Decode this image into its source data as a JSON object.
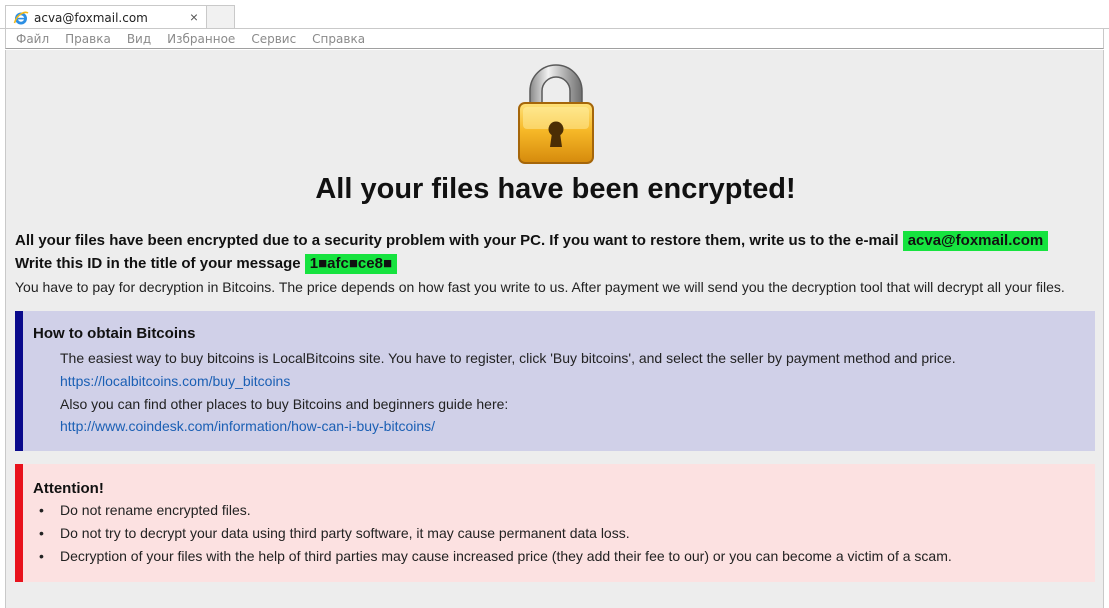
{
  "tab": {
    "title": "acva@foxmail.com",
    "close": "×"
  },
  "menubar": {
    "items": [
      "Файл",
      "Правка",
      "Вид",
      "Избранное",
      "Сервис",
      "Справка"
    ]
  },
  "page": {
    "headline": "All your files have been encrypted!",
    "line1_text": "All your files have been encrypted due to a security problem with your PC. If you want to restore them, write us to the e-mail",
    "email": "acva@foxmail.com",
    "line2_text": "Write this ID in the title of your message",
    "id": "1■afc■ce8■",
    "line3_text": "You have to pay for decryption in Bitcoins. The price depends on how fast you write to us. After payment we will send you the decryption tool that will decrypt all your files."
  },
  "bitcoins_box": {
    "title": "How to obtain Bitcoins",
    "text1": "The easiest way to buy bitcoins is LocalBitcoins site. You have to register, click 'Buy bitcoins', and select the seller by payment method and price.",
    "link1": "https://localbitcoins.com/buy_bitcoins",
    "text2": "Also you can find other places to buy Bitcoins and beginners guide here:",
    "link2": "http://www.coindesk.com/information/how-can-i-buy-bitcoins/",
    "accent_color": "#0a0a8c"
  },
  "attention_box": {
    "title": "Attention!",
    "items": [
      "Do not rename encrypted files.",
      "Do not try to decrypt your data using third party software, it may cause permanent data loss.",
      "Decryption of your files with the help of third parties may cause increased price (they add their fee to our) or you can become a victim of a scam."
    ],
    "accent_color": "#e8121c"
  },
  "highlight_color": "#16e33f",
  "icons": {
    "tab_icon": "internet-explorer-icon",
    "lock_icon": "padlock-icon"
  }
}
